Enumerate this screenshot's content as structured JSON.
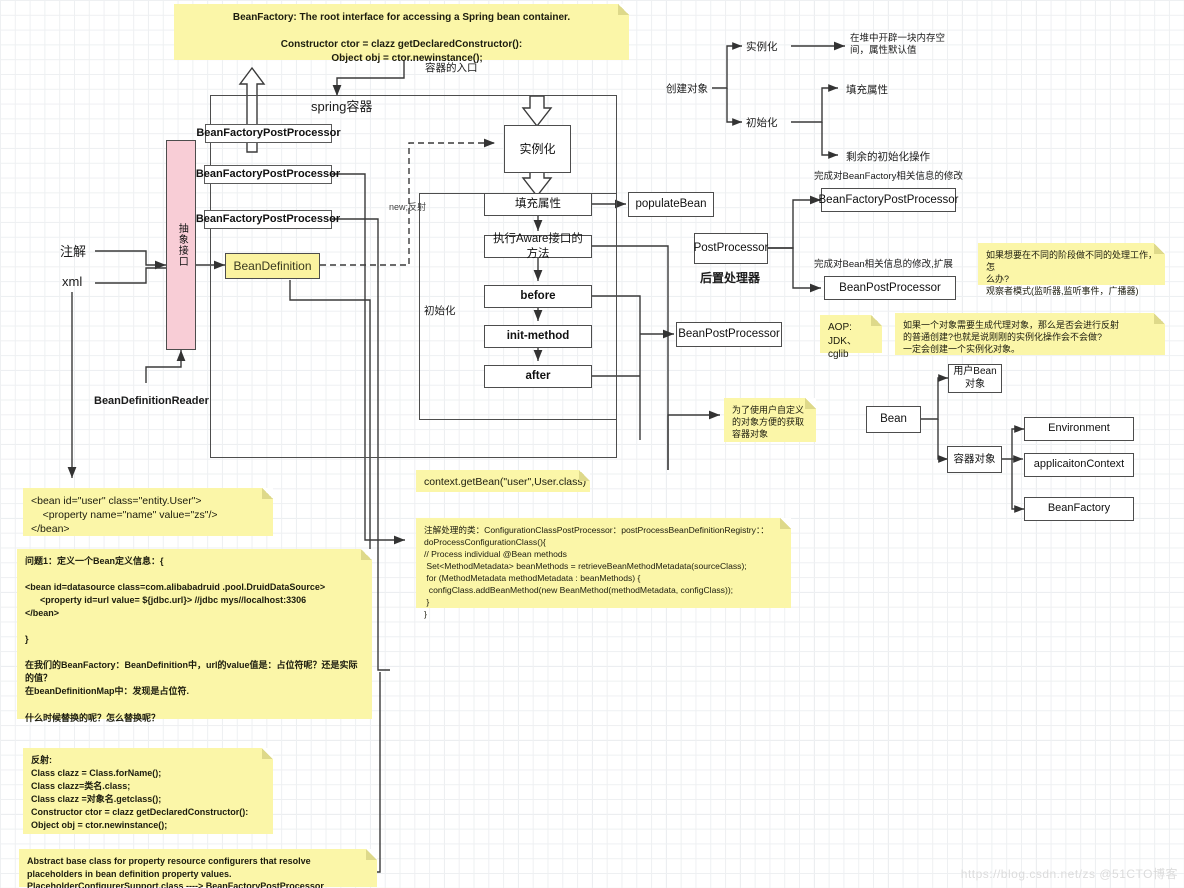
{
  "diagram": {
    "title_note": "BeanFactory: The root interface for accessing a Spring bean container.\n\nConstructor ctor = clazz getDeclaredConstructor():\n    Object obj = ctor.newinstance();",
    "container_entry_label": "容器的入口",
    "spring_container_label": "spring容器",
    "init_group_label": "初始化",
    "new_reflect_label": "new;反射",
    "abstract_interface": "抽象接口",
    "bean_definition_reader": "BeanDefinitionReader",
    "post_processor_group_label": "后置处理器",
    "watermark": "https://blog.csdn.net/zs  @51CTO博客"
  },
  "sources": {
    "annotation": "注解",
    "xml": "xml"
  },
  "bean_factory_post_processors": [
    {
      "label": "BeanFactoryPostProcessor"
    },
    {
      "label": "BeanFactoryPostProcessor"
    },
    {
      "label": "BeanFactoryPostProcessor"
    }
  ],
  "bean_definition": {
    "label": "BeanDefinition"
  },
  "lifecycle": {
    "instantiate": "实例化",
    "steps": [
      {
        "label": "填充属性"
      },
      {
        "label": "执行Aware接口的方法"
      },
      {
        "label": "before"
      },
      {
        "label": "init-method"
      },
      {
        "label": "after"
      }
    ]
  },
  "right_column": {
    "populate_bean": "populateBean",
    "post_processor": "PostProcessor",
    "bean_post_processor": "BeanPostProcessor",
    "bean_factory_post_processor": "BeanFactoryPostProcessor",
    "bean_post_processor_2": "BeanPostProcessor",
    "caption_bean_factory": "完成对BeanFactory相关信息的修改",
    "caption_bean": "完成对Bean相关信息的修改,扩展"
  },
  "create_object_tree": {
    "root": "创建对象",
    "instantiate": "实例化",
    "instantiate_detail": "在堆中开辟一块内存空\n间，属性默认值",
    "initialize": "初始化",
    "initialize_children": [
      "填充属性",
      "剩余的初始化操作"
    ]
  },
  "bean_tree": {
    "root": "Bean",
    "user_bean": "用户Bean\n对象",
    "container_object": "容器对象",
    "container_children": [
      "Environment",
      "applicaitonContext",
      "BeanFactory"
    ]
  },
  "notes": {
    "observer_pattern": "如果想要在不同的阶段做不同的处理工作，怎\n么办?\n观察者模式(监听器,监听事件，广播器)",
    "aop": "AOP:\nJDK、cglib",
    "proxy_question": "如果一个对象需要生成代理对象，那么是否会进行反射\n的普通创建?也就是说刚刚的实例化操作会不会做?\n一定会创建一个实例化对象。",
    "container_object_reason": "为了使用户自定义\n的对象方便的获取\n容器对象",
    "get_bean": "context.getBean(\"user\",User.class)",
    "bean_xml": "<bean id=\"user\" class=\"entity.User\">\n    <property name=\"name\" value=\"zs\"/>\n</bean>",
    "question1": "问题1：定义一个Bean定义信息：{\n\n<bean id=datasource class=com.alibabadruid .pool.DruidDataSource>\n      <property id=url value= ${jdbc.url}> //jdbc mys//localhost:3306\n</bean>\n\n}\n\n在我们的BeanFactory：BeanDefinition中，url的value值是：占位符呢？还是实际的值？\n在beanDefinitionMap中：发现是占位符.\n\n什么时候替换的呢？怎么替换呢？",
    "annotation_processing": "注解处理的类：ConfigurationClassPostProcessor：postProcessBeanDefinitionRegistry：：\ndoProcessConfigurationClass(){\n// Process individual @Bean methods\n Set<MethodMetadata> beanMethods = retrieveBeanMethodMetadata(sourceClass);\n for (MethodMetadata methodMetadata : beanMethods) {\n  configClass.addBeanMethod(new BeanMethod(methodMetadata, configClass));\n }\n}",
    "reflection": "反射:\nClass clazz = Class.forName();\nClass clazz=类名.class;\nClass clazz =对象名.getclass();\nConstructor ctor = clazz getDeclaredConstructor():\nObject obj = ctor.newinstance();",
    "placeholder_configurer": "Abstract base class for property resource configurers that resolve\nplaceholders in bean definition property values.\nPlaceholderConfigurerSupport.class ----> BeanFactoryPostProcessor"
  },
  "colors": {
    "note_yellow": "#fbf6a8",
    "pink": "#f8cdd6",
    "bean_definition_yellow": "#fbf3a0",
    "stroke": "#4d4d4d"
  }
}
